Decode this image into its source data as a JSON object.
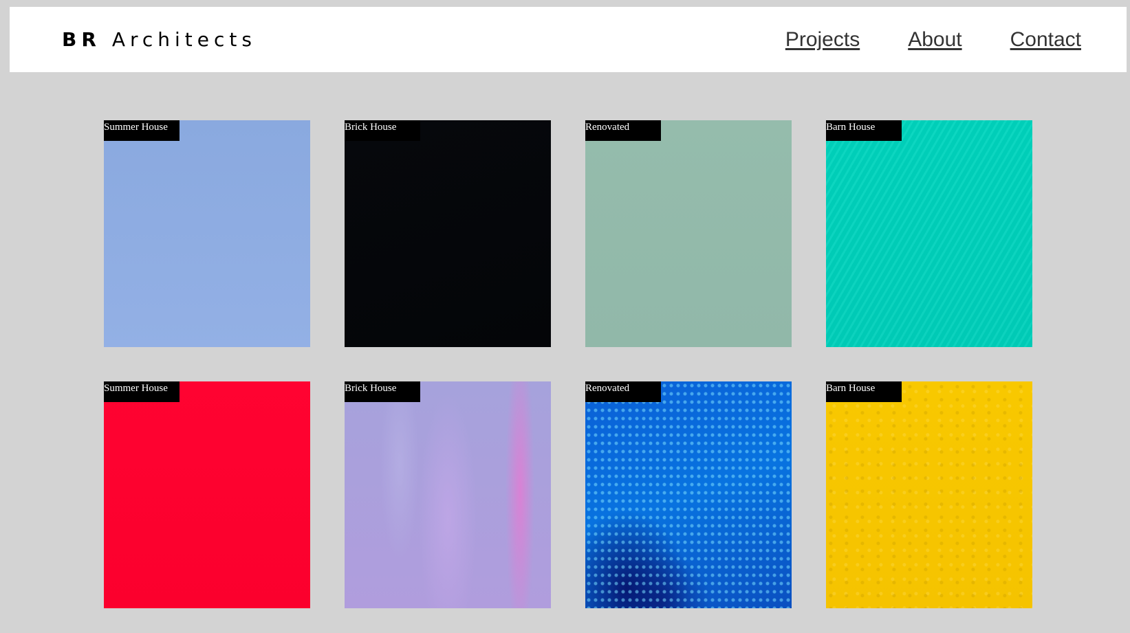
{
  "header": {
    "brand_bold": "BR",
    "brand_rest": "Architects",
    "nav": [
      {
        "label": "Projects"
      },
      {
        "label": "About"
      },
      {
        "label": "Contact"
      }
    ]
  },
  "projects": [
    {
      "label": "Summer House",
      "color": "#8eadE2"
    },
    {
      "label": "Brick House",
      "color": "#05070a"
    },
    {
      "label": "Renovated",
      "color": "#93baab"
    },
    {
      "label": "Barn House",
      "color": "#00d3bd"
    },
    {
      "label": "Summer House",
      "color": "#ff0230"
    },
    {
      "label": "Brick House",
      "color": "#aba0dd"
    },
    {
      "label": "Renovated",
      "color": "#0a66d8"
    },
    {
      "label": "Barn House",
      "color": "#f7c600"
    }
  ]
}
